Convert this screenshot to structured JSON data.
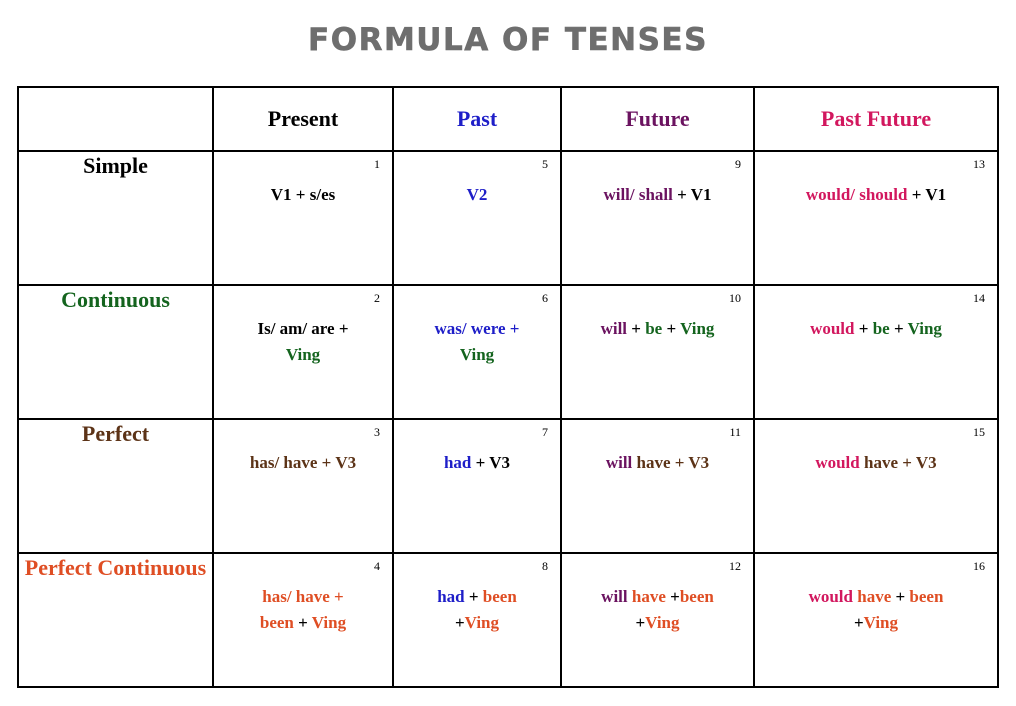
{
  "title": "FORMULA OF TENSES",
  "colors": {
    "title": "#6e6e6e",
    "black": "#000000",
    "blue": "#1e1ec8",
    "green": "#14641e",
    "purple": "#6b1360",
    "pink": "#d2175e",
    "brown": "#5c3317",
    "orange": "#df4e24"
  },
  "table": {
    "corner_label": "",
    "columns": [
      {
        "label": "Present",
        "color": "black"
      },
      {
        "label": "Past",
        "color": "blue"
      },
      {
        "label": "Future",
        "color": "purple"
      },
      {
        "label": "Past Future",
        "color": "pink"
      }
    ],
    "rows": [
      {
        "label": "Simple",
        "label_color": "black",
        "cells": [
          {
            "number": "1",
            "formula": "V1 + s/es"
          },
          {
            "number": "5",
            "formula": "V2"
          },
          {
            "number": "9",
            "formula": "will/ shall + V1"
          },
          {
            "number": "13",
            "formula": "would/ should + V1"
          }
        ]
      },
      {
        "label": "Continuous",
        "label_color": "green",
        "cells": [
          {
            "number": "2",
            "formula": "Is/ am/ are + Ving"
          },
          {
            "number": "6",
            "formula": "was/ were + Ving"
          },
          {
            "number": "10",
            "formula": "will + be + Ving"
          },
          {
            "number": "14",
            "formula": "would + be + Ving"
          }
        ]
      },
      {
        "label": "Perfect",
        "label_color": "brown",
        "cells": [
          {
            "number": "3",
            "formula": "has/ have + V3"
          },
          {
            "number": "7",
            "formula": "had + V3"
          },
          {
            "number": "11",
            "formula": "will have + V3"
          },
          {
            "number": "15",
            "formula": "would have + V3"
          }
        ]
      },
      {
        "label": "Perfect Continuous",
        "label_color": "orange",
        "cells": [
          {
            "number": "4",
            "formula": "has/ have + been + Ving"
          },
          {
            "number": "8",
            "formula": "had + been +Ving"
          },
          {
            "number": "12",
            "formula": "will have +been +Ving"
          },
          {
            "number": "16",
            "formula": "would have + been +Ving"
          }
        ]
      }
    ],
    "cell_parts": {
      "r1c1": [
        {
          "t": "V1 + s/es",
          "c": "black"
        }
      ],
      "r1c2": [
        {
          "t": "V2",
          "c": "blue"
        }
      ],
      "r1c3": [
        {
          "t": "will/ shall ",
          "c": "purple"
        },
        {
          "t": "+ V1",
          "c": "black"
        }
      ],
      "r1c4": [
        {
          "t": "would/ should ",
          "c": "pink"
        },
        {
          "t": "+ V1",
          "c": "black"
        }
      ],
      "r2c1": [
        {
          "t": "Is/ am/ are +",
          "c": "black"
        },
        {
          "t": "\n",
          "c": "black"
        },
        {
          "t": "Ving",
          "c": "green"
        }
      ],
      "r2c2": [
        {
          "t": "was/ were +",
          "c": "blue"
        },
        {
          "t": "\n",
          "c": "black"
        },
        {
          "t": "Ving",
          "c": "green"
        }
      ],
      "r2c3": [
        {
          "t": "will ",
          "c": "purple"
        },
        {
          "t": "+ ",
          "c": "black"
        },
        {
          "t": "be ",
          "c": "green"
        },
        {
          "t": "+ ",
          "c": "black"
        },
        {
          "t": "Ving",
          "c": "green"
        }
      ],
      "r2c4": [
        {
          "t": "would ",
          "c": "pink"
        },
        {
          "t": "+ ",
          "c": "black"
        },
        {
          "t": "be ",
          "c": "green"
        },
        {
          "t": "+ ",
          "c": "black"
        },
        {
          "t": "Ving",
          "c": "green"
        }
      ],
      "r3c1": [
        {
          "t": "has/ have + V3",
          "c": "brown"
        }
      ],
      "r3c2": [
        {
          "t": "had ",
          "c": "blue"
        },
        {
          "t": "+ V3",
          "c": "black"
        }
      ],
      "r3c3": [
        {
          "t": "will ",
          "c": "purple"
        },
        {
          "t": "have + V3",
          "c": "brown"
        }
      ],
      "r3c4": [
        {
          "t": "would ",
          "c": "pink"
        },
        {
          "t": "have + V3",
          "c": "brown"
        }
      ],
      "r4c1": [
        {
          "t": "has/ have +",
          "c": "orange"
        },
        {
          "t": "\n",
          "c": "black"
        },
        {
          "t": "been ",
          "c": "orange"
        },
        {
          "t": "+ ",
          "c": "black"
        },
        {
          "t": "Ving",
          "c": "orange"
        }
      ],
      "r4c2": [
        {
          "t": "had ",
          "c": "blue"
        },
        {
          "t": "+ ",
          "c": "black"
        },
        {
          "t": "been",
          "c": "orange"
        },
        {
          "t": "\n",
          "c": "black"
        },
        {
          "t": "+",
          "c": "black"
        },
        {
          "t": "Ving",
          "c": "orange"
        }
      ],
      "r4c3": [
        {
          "t": "will ",
          "c": "purple"
        },
        {
          "t": "have ",
          "c": "orange"
        },
        {
          "t": "+",
          "c": "black"
        },
        {
          "t": "been",
          "c": "orange"
        },
        {
          "t": "\n",
          "c": "black"
        },
        {
          "t": "+",
          "c": "black"
        },
        {
          "t": "Ving",
          "c": "orange"
        }
      ],
      "r4c4": [
        {
          "t": "would ",
          "c": "pink"
        },
        {
          "t": "have ",
          "c": "orange"
        },
        {
          "t": "+ ",
          "c": "black"
        },
        {
          "t": "been",
          "c": "orange"
        },
        {
          "t": "\n",
          "c": "black"
        },
        {
          "t": "+",
          "c": "black"
        },
        {
          "t": "Ving",
          "c": "orange"
        }
      ]
    }
  }
}
